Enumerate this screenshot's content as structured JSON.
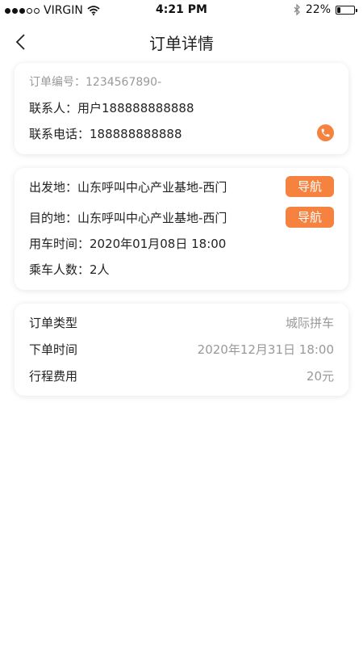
{
  "status": {
    "carrier": "VIRGIN",
    "time": "4:21 PM",
    "battery": "22%",
    "battery_level": 0.22
  },
  "header": {
    "title": "订单详情"
  },
  "contact": {
    "order_no": "订单编号：1234567890-",
    "contact_person": "联系人：用户188888888888",
    "contact_phone": "联系电话：188888888888"
  },
  "route": {
    "departure": "出发地：山东呼叫中心产业基地-西门",
    "destination": "目的地：山东呼叫中心产业基地-西门",
    "nav_label": "导航",
    "time": "用车时间：2020年01月08日  18:00",
    "passengers": "乘车人数：2人"
  },
  "info": [
    {
      "label": "订单类型",
      "value": "城际拼车"
    },
    {
      "label": "下单时间",
      "value": "2020年12月31日 18:00"
    },
    {
      "label": "行程费用",
      "value": "20元"
    }
  ],
  "colors": {
    "accent": "#f5823f"
  },
  "icons": [
    "signal-icon",
    "wifi-icon",
    "bluetooth-icon",
    "battery-icon",
    "back-icon",
    "phone-icon"
  ]
}
